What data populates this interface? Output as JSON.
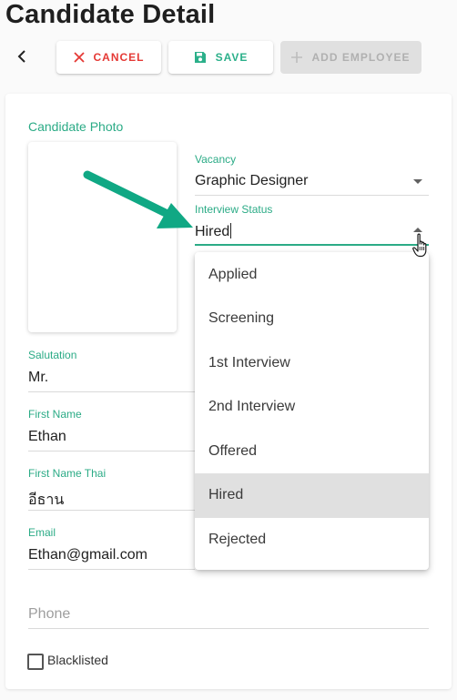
{
  "page": {
    "title": "Candidate Detail"
  },
  "toolbar": {
    "cancel_label": "CANCEL",
    "save_label": "SAVE",
    "add_employee_label": "ADD EMPLOYEE"
  },
  "colors": {
    "accent": "#2bab86",
    "danger": "#e53935",
    "disabled": "#b0b0b0",
    "annotation_arrow": "#10a884"
  },
  "photo": {
    "label": "Candidate Photo"
  },
  "fields": {
    "vacancy": {
      "label": "Vacancy",
      "value": "Graphic Designer"
    },
    "interview_status": {
      "label": "Interview Status",
      "value": "Hired"
    },
    "salutation": {
      "label": "Salutation",
      "value": "Mr."
    },
    "first_name": {
      "label": "First Name",
      "value": "Ethan"
    },
    "first_name_thai": {
      "label": "First Name Thai",
      "value": "อีธาน"
    },
    "email": {
      "label": "Email",
      "value": "Ethan@gmail.com"
    },
    "phone": {
      "placeholder": "Phone"
    }
  },
  "status_dropdown": {
    "options": [
      "Applied",
      "Screening",
      "1st Interview",
      "2nd Interview",
      "Offered",
      "Hired",
      "Rejected"
    ],
    "selected": "Hired"
  },
  "blacklisted": {
    "label": "Blacklisted",
    "checked": false
  },
  "icons": {
    "back": "chevron-left-icon",
    "cancel": "close-icon",
    "save": "floppy-disk-icon",
    "add": "plus-icon",
    "dropdown": "caret-down-icon",
    "cursor": "hand-pointer-icon",
    "annotation": "arrow-icon"
  }
}
